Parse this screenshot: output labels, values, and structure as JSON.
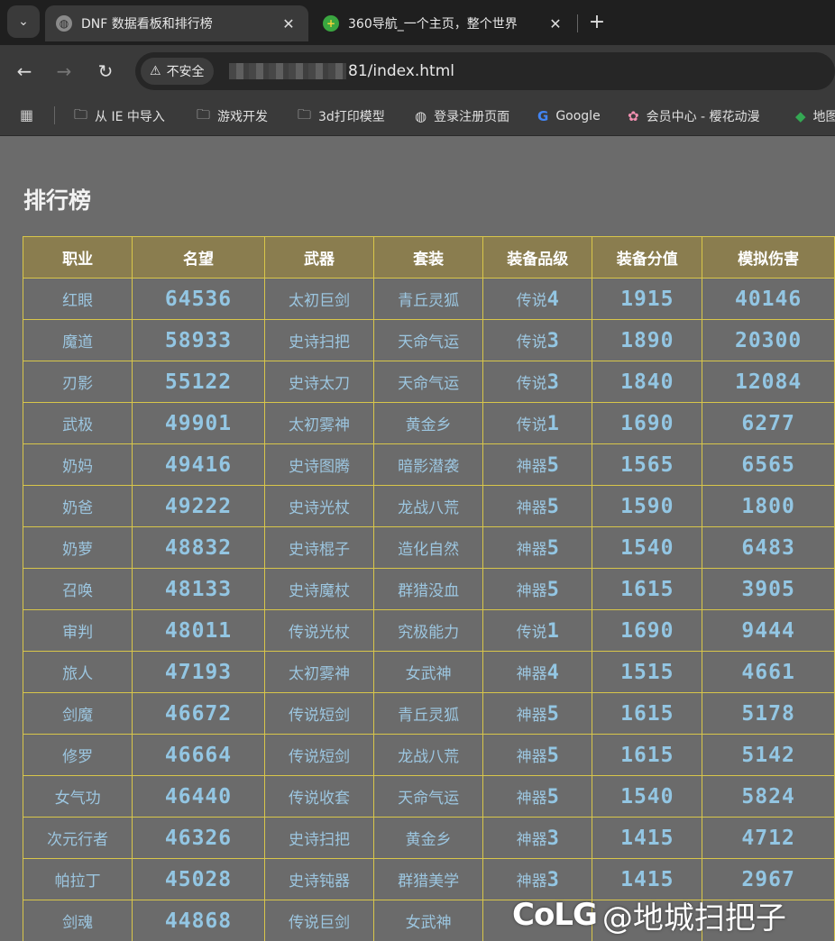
{
  "browser": {
    "tabs": [
      {
        "title": "DNF 数据看板和排行榜",
        "active": true,
        "icon": "globe-icon"
      },
      {
        "title": "360导航_一个主页，整个世界",
        "active": false,
        "icon": "360-icon"
      }
    ],
    "new_tab": "+",
    "close": "✕",
    "security_label": "不安全",
    "url_suffix": "81/index.html",
    "bookmarks": [
      {
        "label": "从 IE 中导入",
        "icon": "folder-icon"
      },
      {
        "label": "游戏开发",
        "icon": "folder-icon"
      },
      {
        "label": "3d打印模型",
        "icon": "folder-icon"
      },
      {
        "label": "登录注册页面",
        "icon": "globe-icon"
      },
      {
        "label": "Google",
        "icon": "google-icon"
      },
      {
        "label": "会员中心 - 樱花动漫",
        "icon": "sakura-icon"
      },
      {
        "label": "地图",
        "icon": "maps-icon"
      }
    ]
  },
  "page": {
    "title": "排行榜",
    "headers": [
      "职业",
      "名望",
      "武器",
      "套装",
      "装备品级",
      "装备分值",
      "模拟伤害"
    ],
    "rows": [
      {
        "job": "红眼",
        "fame": "64536",
        "weapon": "太初巨剑",
        "set": "青丘灵狐",
        "grade_word": "传说",
        "grade_num": "4",
        "score": "1915",
        "damage": "40146"
      },
      {
        "job": "魔道",
        "fame": "58933",
        "weapon": "史诗扫把",
        "set": "天命气运",
        "grade_word": "传说",
        "grade_num": "3",
        "score": "1890",
        "damage": "20300"
      },
      {
        "job": "刃影",
        "fame": "55122",
        "weapon": "史诗太刀",
        "set": "天命气运",
        "grade_word": "传说",
        "grade_num": "3",
        "score": "1840",
        "damage": "12084"
      },
      {
        "job": "武极",
        "fame": "49901",
        "weapon": "太初雾神",
        "set": "黄金乡",
        "grade_word": "传说",
        "grade_num": "1",
        "score": "1690",
        "damage": "6277"
      },
      {
        "job": "奶妈",
        "fame": "49416",
        "weapon": "史诗图腾",
        "set": "暗影潜袭",
        "grade_word": "神器",
        "grade_num": "5",
        "score": "1565",
        "damage": "6565"
      },
      {
        "job": "奶爸",
        "fame": "49222",
        "weapon": "史诗光杖",
        "set": "龙战八荒",
        "grade_word": "神器",
        "grade_num": "5",
        "score": "1590",
        "damage": "1800"
      },
      {
        "job": "奶萝",
        "fame": "48832",
        "weapon": "史诗棍子",
        "set": "造化自然",
        "grade_word": "神器",
        "grade_num": "5",
        "score": "1540",
        "damage": "6483"
      },
      {
        "job": "召唤",
        "fame": "48133",
        "weapon": "史诗魔杖",
        "set": "群猎没血",
        "grade_word": "神器",
        "grade_num": "5",
        "score": "1615",
        "damage": "3905"
      },
      {
        "job": "审判",
        "fame": "48011",
        "weapon": "传说光杖",
        "set": "究极能力",
        "grade_word": "传说",
        "grade_num": "1",
        "score": "1690",
        "damage": "9444"
      },
      {
        "job": "旅人",
        "fame": "47193",
        "weapon": "太初雾神",
        "set": "女武神",
        "grade_word": "神器",
        "grade_num": "4",
        "score": "1515",
        "damage": "4661"
      },
      {
        "job": "剑魔",
        "fame": "46672",
        "weapon": "传说短剑",
        "set": "青丘灵狐",
        "grade_word": "神器",
        "grade_num": "5",
        "score": "1615",
        "damage": "5178"
      },
      {
        "job": "修罗",
        "fame": "46664",
        "weapon": "传说短剑",
        "set": "龙战八荒",
        "grade_word": "神器",
        "grade_num": "5",
        "score": "1615",
        "damage": "5142"
      },
      {
        "job": "女气功",
        "fame": "46440",
        "weapon": "传说收套",
        "set": "天命气运",
        "grade_word": "神器",
        "grade_num": "5",
        "score": "1540",
        "damage": "5824"
      },
      {
        "job": "次元行者",
        "fame": "46326",
        "weapon": "史诗扫把",
        "set": "黄金乡",
        "grade_word": "神器",
        "grade_num": "3",
        "score": "1415",
        "damage": "4712"
      },
      {
        "job": "帕拉丁",
        "fame": "45028",
        "weapon": "史诗钝器",
        "set": "群猎美学",
        "grade_word": "神器",
        "grade_num": "3",
        "score": "1415",
        "damage": "2967"
      },
      {
        "job": "剑魂",
        "fame": "44868",
        "weapon": "传说巨剑",
        "set": "女武神",
        "grade_word": "",
        "grade_num": "",
        "score": "",
        "damage": ""
      }
    ]
  },
  "watermark": {
    "logo": "CoLG",
    "handle": "@地城扫把子"
  }
}
